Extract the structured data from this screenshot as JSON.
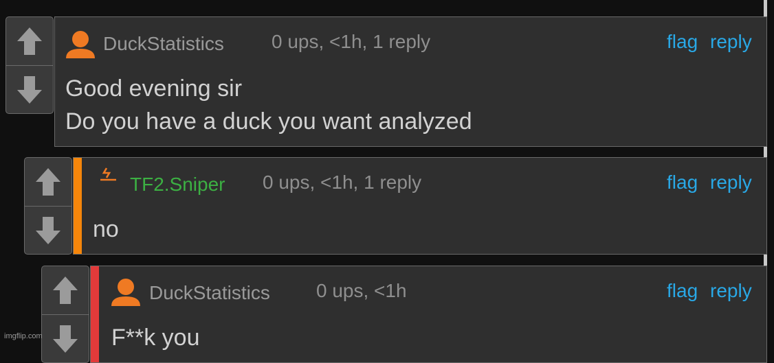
{
  "comments": [
    {
      "user": "DuckStatistics",
      "meta": "0 ups, <1h, 1 reply",
      "flag": "flag",
      "reply": "reply",
      "lines": [
        "Good evening sir",
        "Do you have a duck you want analyzed"
      ],
      "user_color": "#9a9a9a",
      "depth_color": null
    },
    {
      "user": "TF2.Sniper",
      "meta": "0 ups, <1h, 1 reply",
      "flag": "flag",
      "reply": "reply",
      "lines": [
        "no"
      ],
      "user_color": "#3cb043",
      "depth_color": "#f5860b"
    },
    {
      "user": "DuckStatistics",
      "meta": "0 ups, <1h",
      "flag": "flag",
      "reply": "reply",
      "lines": [
        "F**k you"
      ],
      "user_color": "#9a9a9a",
      "depth_color": "#e23a3a"
    }
  ],
  "icons": {
    "upvote": "arrow-up-icon",
    "downvote": "arrow-down-icon",
    "avatar": "user-avatar-icon",
    "flair": "lightning-flair-icon"
  },
  "colors": {
    "link": "#29a8e6",
    "background": "#101010",
    "panel": "#2f2f2f",
    "avatar": "#ef7a23"
  },
  "watermark": "imgflip.com"
}
